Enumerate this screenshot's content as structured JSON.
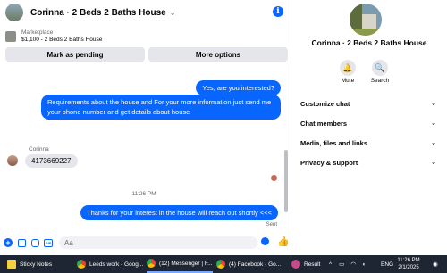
{
  "header": {
    "title": "Corinna · 2 Beds 2 Baths House",
    "chevron": "⌄"
  },
  "listing": {
    "label": "Marketplace",
    "price_title": "$1,100 - 2 Beds 2 Baths House"
  },
  "actions": {
    "mark_pending": "Mark as pending",
    "more_options": "More options"
  },
  "messages": {
    "out_1": "Yes, are you interested?",
    "out_2": "Requirements about the house and For  your  more  information  just  send  me   your  phone  number  and  get details about house",
    "sender_name": "Corinna",
    "in_1": "4173669227",
    "timestamp": "11:26 PM",
    "out_3": "Thanks for your interest in the house will reach out shortly  <<<",
    "status": "Sent"
  },
  "composer": {
    "placeholder": "Aa"
  },
  "panel": {
    "title": "Corinna · 2 Beds 2 Baths House",
    "mute_label": "Mute",
    "search_label": "Search",
    "sections": [
      "Customize chat",
      "Chat members",
      "Media, files and links",
      "Privacy & support"
    ]
  },
  "taskbar": {
    "items": [
      "Sticky Notes",
      "Leeds work - Goog...",
      "(12) Messenger | F...",
      "(4) Facebook - Go..."
    ],
    "weather": "Result",
    "lang": "ENG",
    "time": "11:26 PM",
    "date": "2/1/2025"
  },
  "colors": {
    "accent": "#0866ff",
    "bubble_in": "#e4e6eb",
    "taskbar": "#1f2633"
  }
}
